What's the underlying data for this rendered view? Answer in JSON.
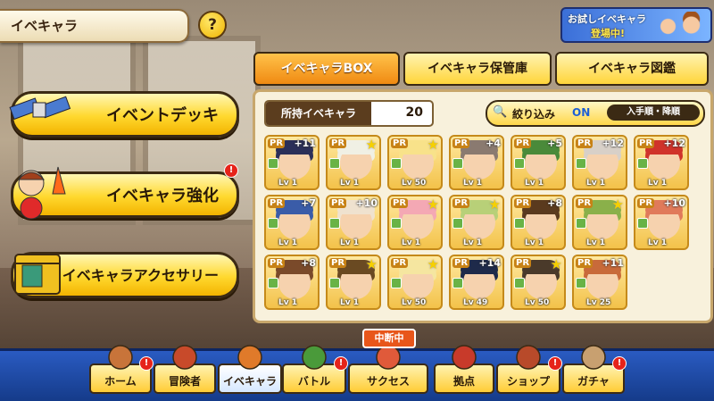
{
  "header": {
    "title": "イベキャラ",
    "help": "?"
  },
  "promo": {
    "line1": "お試しイベキャラ",
    "line2": "登場中!"
  },
  "menu": [
    {
      "label": "イベントデッキ",
      "badge": ""
    },
    {
      "label": "イベキャラ強化",
      "badge": "!"
    },
    {
      "label": "イベキャラアクセサリー",
      "badge": ""
    }
  ],
  "tabs": [
    {
      "label": "イベキャラBOX",
      "active": true
    },
    {
      "label": "イベキャラ保管庫",
      "active": false
    },
    {
      "label": "イベキャラ図鑑",
      "active": false
    }
  ],
  "owned": {
    "label": "所持イベキャラ",
    "count": "20"
  },
  "filter": {
    "label": "絞り込み",
    "state": "ON",
    "sort": "入手順・降順"
  },
  "cards": [
    {
      "badge": "+11",
      "level": "Lv 1",
      "hair": "#2b2f58"
    },
    {
      "badge": "★",
      "level": "Lv 1",
      "hair": "#f0f0e4"
    },
    {
      "badge": "★",
      "level": "Lv 50",
      "hair": "#f8e28a"
    },
    {
      "badge": "+4",
      "level": "Lv 1",
      "hair": "#8a7a70"
    },
    {
      "badge": "+5",
      "level": "Lv 1",
      "hair": "#4a8a3a"
    },
    {
      "badge": "+12",
      "level": "Lv 1",
      "hair": "#d8d0c8"
    },
    {
      "badge": "+12",
      "level": "Lv 1",
      "hair": "#d0332a"
    },
    {
      "badge": "+7",
      "level": "Lv 1",
      "hair": "#3a5ca8"
    },
    {
      "badge": "+10",
      "level": "Lv 1",
      "hair": "#efe2cf"
    },
    {
      "badge": "★",
      "level": "Lv 1",
      "hair": "#f4a8b4"
    },
    {
      "badge": "★",
      "level": "Lv 1",
      "hair": "#b8d078"
    },
    {
      "badge": "+8",
      "level": "Lv 1",
      "hair": "#5a3a1e"
    },
    {
      "badge": "★",
      "level": "Lv 1",
      "hair": "#8ab04a"
    },
    {
      "badge": "+10",
      "level": "Lv 1",
      "hair": "#e07a5a"
    },
    {
      "badge": "+8",
      "level": "Lv 1",
      "hair": "#7a4a2a"
    },
    {
      "badge": "★",
      "level": "Lv 1",
      "hair": "#6a4a22"
    },
    {
      "badge": "★",
      "level": "Lv 50",
      "hair": "#f5e6a0"
    },
    {
      "badge": "+14",
      "level": "Lv 49",
      "hair": "#1e2a4a"
    },
    {
      "badge": "★",
      "level": "Lv 50",
      "hair": "#4a3a2a"
    },
    {
      "badge": "+11",
      "level": "Lv 25",
      "hair": "#c86a3a"
    }
  ],
  "nav": [
    {
      "label": "ホーム",
      "badge": "!",
      "active": false
    },
    {
      "label": "冒険者",
      "badge": "",
      "active": false
    },
    {
      "label": "イベキャラ",
      "badge": "",
      "active": true
    },
    {
      "label": "バトル",
      "badge": "!",
      "active": false
    },
    {
      "label": "サクセス",
      "badge": "",
      "active": false
    },
    {
      "label": "拠点",
      "badge": "",
      "active": false
    },
    {
      "label": "ショップ",
      "badge": "!",
      "active": false
    },
    {
      "label": "ガチャ",
      "badge": "!",
      "active": false
    }
  ],
  "suspended": "中断中"
}
